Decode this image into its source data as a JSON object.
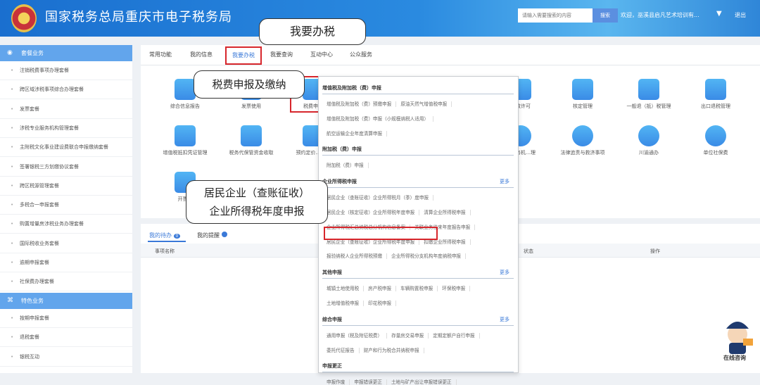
{
  "header": {
    "title": "国家税务总局重庆市电子税务局",
    "search_placeholder": "请输入需要搜索的内容",
    "search_button": "搜索",
    "welcome": "欢迎，巫溪县启凡艺术培训有...",
    "logout": "退出"
  },
  "sidebar": {
    "section1": "套餐业务",
    "items1": [
      "注销税费事项办理套餐",
      "跨区域涉税事项综合办理套餐",
      "发票套餐",
      "涉税专业服务机构管理套餐",
      "主附税文化事业建设费联合申报缴纳套餐",
      "签署银税三方划缴协议套餐",
      "跨区税源管理套餐",
      "多税合一申报套餐",
      "购置增量房涉税业务办理套餐",
      "国际税收业务套餐",
      "逾期申报套餐",
      "社保费办理套餐"
    ],
    "section2": "特色业务",
    "items2": [
      "按期申报套餐",
      "退税套餐",
      "银税互动"
    ]
  },
  "nav": {
    "tabs": [
      "常用功能",
      "我的信息",
      "我要办税",
      "我要查询",
      "互动中心",
      "公众服务"
    ]
  },
  "tiles": {
    "row1": [
      "综合信息报告",
      "发票使用",
      "税费申报",
      "…政许可",
      "核定管理",
      "一般退（抵）税管理",
      "出口退税管理"
    ],
    "row2": [
      "增值税抵扣凭证管理",
      "税务代保管资金收取",
      "预约定价…签…",
      "…服务机…理",
      "法律追责与救济事项",
      "川渝通办",
      "单位社保费"
    ],
    "row3": [
      "开票…"
    ]
  },
  "todo": {
    "tab1": "我的待办",
    "tab1_count": "0",
    "tab2": "我的提醒",
    "col_name": "事项名称",
    "col_status": "状态",
    "col_action": "操作"
  },
  "dropdown": {
    "sections": [
      {
        "title": "增值税及附加税（费）申报",
        "more": "",
        "rows": [
          [
            "增值税及附加税（费）预缴申报",
            "原油天然气增值税申报"
          ],
          [
            "增值税及附加税（费）申报（小规模纳税人适用）"
          ],
          [
            "航空运输企业年度清算申报"
          ]
        ]
      },
      {
        "title": "附加税（费）申报",
        "more": "",
        "rows": [
          [
            "附加税（费）申报"
          ]
        ]
      },
      {
        "title": "企业所得税申报",
        "more": "更多",
        "rows": [
          [
            "居民企业（查账征收）企业所得税月（季）度申报"
          ],
          [
            "居民企业（核定征收）企业所得税年度申报",
            "清算企业所得税申报"
          ],
          [
            "企业所得税汇总纳税总分机构信息备案",
            "关联业务往来年度报告申报"
          ],
          [
            "居民企业（查账征收）企业所得税年度申报",
            "扣缴企业所得税申报"
          ],
          [
            "报验纳税人企业所得税预缴",
            "企业所得税分支机构年度纳税申报"
          ]
        ]
      },
      {
        "title": "其他申报",
        "more": "更多",
        "rows": [
          [
            "城镇土地使用税",
            "房产税申报",
            "车辆购置税申报",
            "环保税申报"
          ],
          [
            "土地增值税申报",
            "印花税申报"
          ]
        ]
      },
      {
        "title": "综合申报",
        "more": "更多",
        "rows": [
          [
            "通用申报（税及附征税费）",
            "存量房交易申报",
            "定期定额户自行申报"
          ],
          [
            "委托代征报告",
            "财产和行为税合并纳税申报"
          ]
        ]
      },
      {
        "title": "申报更正",
        "more": "",
        "rows": [
          [
            "申报作废",
            "申报错误更正",
            "土地与矿产出让申报错误更正"
          ]
        ]
      }
    ]
  },
  "callouts": {
    "c1": "我要办税",
    "c2": "税费申报及缴纳",
    "c3_line1": "居民企业（查账征收）",
    "c3_line2": "企业所得税年度申报"
  },
  "mascot": {
    "label": "在线咨询"
  }
}
